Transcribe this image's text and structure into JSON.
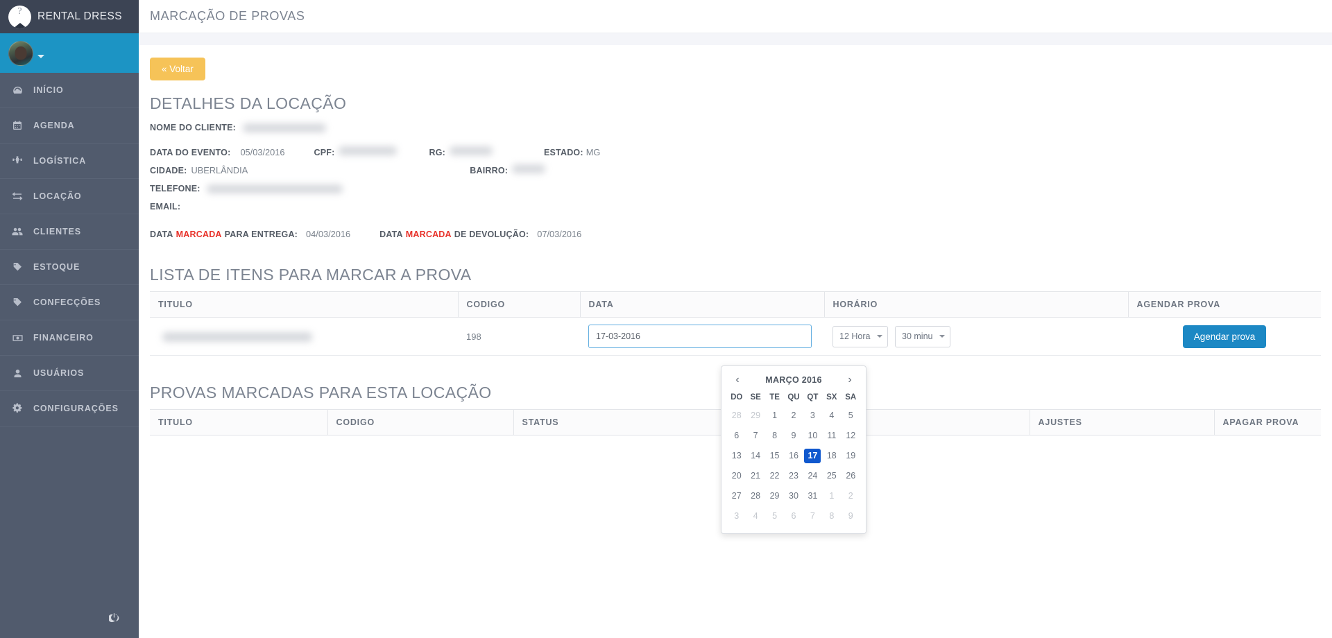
{
  "brand": {
    "name": "RENTAL DRESS",
    "logo_icon": "hanger-logo-icon"
  },
  "sidebar": {
    "items": [
      {
        "label": "INÍCIO",
        "icon": "dashboard-icon"
      },
      {
        "label": "AGENDA",
        "icon": "calendar-icon"
      },
      {
        "label": "LOGÍSTICA",
        "icon": "sitemap-icon"
      },
      {
        "label": "LOCAÇÃO",
        "icon": "exchange-icon"
      },
      {
        "label": "CLIENTES",
        "icon": "users-icon"
      },
      {
        "label": "ESTOQUE",
        "icon": "tag-icon"
      },
      {
        "label": "CONFECÇÕES",
        "icon": "tag-icon"
      },
      {
        "label": "FINANCEIRO",
        "icon": "money-icon"
      },
      {
        "label": "USUÁRIOS",
        "icon": "user-icon"
      },
      {
        "label": "CONFIGURAÇÕES",
        "icon": "gears-icon"
      }
    ],
    "logout_icon": "power-icon"
  },
  "header": {
    "title": "MARCAÇÃO DE PROVAS"
  },
  "toolbar": {
    "back_label": "« Voltar"
  },
  "details": {
    "title": "DETALHES DA LOCAÇÃO",
    "client_label": "NOME DO CLIENTE:",
    "client_value": "",
    "event_date_label": "DATA DO EVENTO:",
    "event_date_value": "05/03/2016",
    "cpf_label": "CPF:",
    "cpf_value": "",
    "rg_label": "RG:",
    "rg_value": "",
    "state_label": "ESTADO:",
    "state_value": "MG",
    "city_label": "CIDADE:",
    "city_value": "UBERLÂNDIA",
    "district_label": "BAIRRO:",
    "district_value": "",
    "phone_label": "TELEFONE:",
    "phone_value": "",
    "email_label": "EMAIL:",
    "email_value": "",
    "delivery_prefix": "DATA",
    "delivery_marked": "MARCADA",
    "delivery_suffix": "PARA ENTREGA:",
    "delivery_date": "04/03/2016",
    "return_prefix": "DATA",
    "return_marked": "MARCADA",
    "return_suffix": "DE DEVOLUÇÃO:",
    "return_date": "07/03/2016"
  },
  "items_section": {
    "title": "LISTA DE ITENS PARA MARCAR A PROVA",
    "columns": [
      "TITULO",
      "CODIGO",
      "DATA",
      "HORÁRIO",
      "AGENDAR PROVA"
    ],
    "row": {
      "titulo": "",
      "codigo": "198",
      "data_value": "17-03-2016",
      "hora_value": "12 Hora",
      "minuto_value": "30 minu",
      "hora_options": [
        "12 Hora"
      ],
      "minuto_options": [
        "30 minu"
      ],
      "action_label": "Agendar prova"
    }
  },
  "datepicker": {
    "prev_icon": "chevron-left-icon",
    "next_icon": "chevron-right-icon",
    "title": "MARÇO 2016",
    "weekdays": [
      "DO",
      "SE",
      "TE",
      "QU",
      "QT",
      "SX",
      "SA"
    ],
    "selected_day": "17",
    "weeks": [
      [
        {
          "d": "28",
          "m": true
        },
        {
          "d": "29",
          "m": true
        },
        {
          "d": "1"
        },
        {
          "d": "2"
        },
        {
          "d": "3"
        },
        {
          "d": "4"
        },
        {
          "d": "5"
        }
      ],
      [
        {
          "d": "6"
        },
        {
          "d": "7"
        },
        {
          "d": "8"
        },
        {
          "d": "9"
        },
        {
          "d": "10"
        },
        {
          "d": "11"
        },
        {
          "d": "12"
        }
      ],
      [
        {
          "d": "13"
        },
        {
          "d": "14"
        },
        {
          "d": "15"
        },
        {
          "d": "16"
        },
        {
          "d": "17",
          "sel": true
        },
        {
          "d": "18"
        },
        {
          "d": "19"
        }
      ],
      [
        {
          "d": "20"
        },
        {
          "d": "21"
        },
        {
          "d": "22"
        },
        {
          "d": "23"
        },
        {
          "d": "24"
        },
        {
          "d": "25"
        },
        {
          "d": "26"
        }
      ],
      [
        {
          "d": "27"
        },
        {
          "d": "28"
        },
        {
          "d": "29"
        },
        {
          "d": "30"
        },
        {
          "d": "31"
        },
        {
          "d": "1",
          "m": true
        },
        {
          "d": "2",
          "m": true
        }
      ],
      [
        {
          "d": "3",
          "m": true
        },
        {
          "d": "4",
          "m": true
        },
        {
          "d": "5",
          "m": true
        },
        {
          "d": "6",
          "m": true
        },
        {
          "d": "7",
          "m": true
        },
        {
          "d": "8",
          "m": true
        },
        {
          "d": "9",
          "m": true
        }
      ]
    ]
  },
  "booked_section": {
    "title": "PROVAS MARCADAS PARA ESTA LOCAÇÃO",
    "columns": [
      "TITULO",
      "CODIGO",
      "STATUS",
      "",
      "AJUSTES",
      "APAGAR PROVA"
    ]
  },
  "colors": {
    "sidebar": "#515B6D",
    "sidebar_dark": "#3C4454",
    "accent_blue": "#1C94C4",
    "warning": "#F6C358",
    "danger": "#E8332B",
    "selected": "#1058CE"
  }
}
